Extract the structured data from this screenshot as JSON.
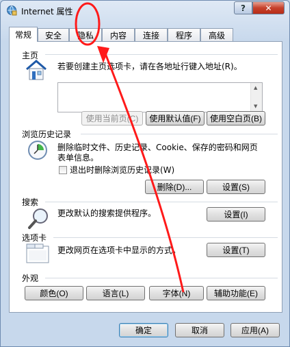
{
  "window": {
    "title": "Internet 属性",
    "help_label": "?",
    "close_label": "✕"
  },
  "tabs": [
    {
      "label": "常规",
      "active": true
    },
    {
      "label": "安全"
    },
    {
      "label": "隐私"
    },
    {
      "label": "内容"
    },
    {
      "label": "连接"
    },
    {
      "label": "程序"
    },
    {
      "label": "高级"
    }
  ],
  "home": {
    "section_title": "主页",
    "description": "若要创建主页选项卡，请在各地址行键入地址(R)。",
    "address_value": "",
    "use_current_label": "使用当前页(C)",
    "use_default_label": "使用默认值(F)",
    "use_blank_label": "使用空白页(B)"
  },
  "history": {
    "section_title": "浏览历史记录",
    "description": "删除临时文件、历史记录、Cookie、保存的密码和网页表单信息。",
    "checkbox_label": "退出时删除浏览历史记录(W)",
    "delete_label": "删除(D)...",
    "settings_label": "设置(S)"
  },
  "search": {
    "section_title": "搜索",
    "description": "更改默认的搜索提供程序。",
    "settings_label": "设置(I)"
  },
  "tabs_section": {
    "section_title": "选项卡",
    "description": "更改网页在选项卡中显示的方式。",
    "settings_label": "设置(T)"
  },
  "appearance": {
    "section_title": "外观",
    "colors_label": "颜色(O)",
    "languages_label": "语言(L)",
    "fonts_label": "字体(N)",
    "accessibility_label": "辅助功能(E)"
  },
  "footer": {
    "ok_label": "确定",
    "cancel_label": "取消",
    "apply_label": "应用(A)"
  },
  "colors": {
    "annotation_red": "#ff1a1a",
    "panel_border": "#8e9fb5"
  }
}
